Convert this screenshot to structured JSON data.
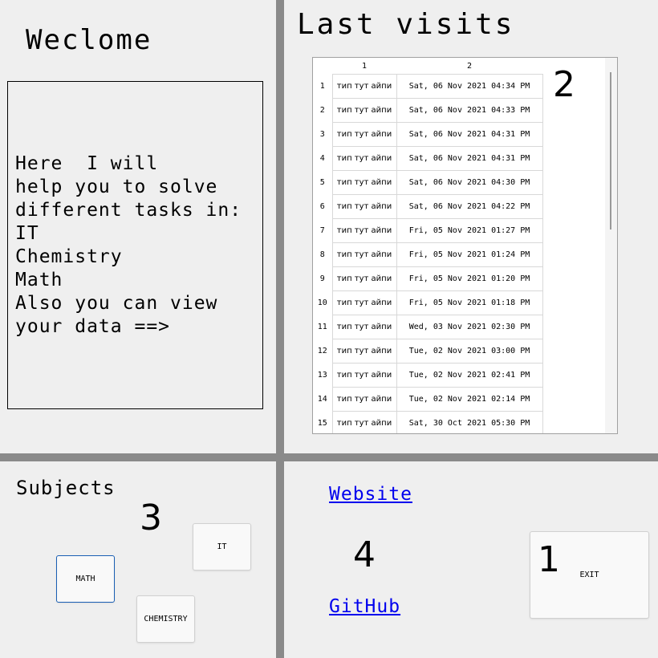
{
  "welcome": {
    "title": "Weclome",
    "lines": [
      "Here  I will",
      "help you to solve",
      "different tasks in:",
      "IT",
      "Chemistry",
      "Math",
      "Also you can view",
      "your data ==>"
    ]
  },
  "visits": {
    "title": "Last visits",
    "columns": [
      "1",
      "2"
    ],
    "rows": [
      {
        "num": "1",
        "name": "тип тут айпи",
        "date": "Sat, 06 Nov 2021 04:34 PM"
      },
      {
        "num": "2",
        "name": "тип тут айпи",
        "date": "Sat, 06 Nov 2021 04:33 PM"
      },
      {
        "num": "3",
        "name": "тип тут айпи",
        "date": "Sat, 06 Nov 2021 04:31 PM"
      },
      {
        "num": "4",
        "name": "тип тут айпи",
        "date": "Sat, 06 Nov 2021 04:31 PM"
      },
      {
        "num": "5",
        "name": "тип тут айпи",
        "date": "Sat, 06 Nov 2021 04:30 PM"
      },
      {
        "num": "6",
        "name": "тип тут айпи",
        "date": "Sat, 06 Nov 2021 04:22 PM"
      },
      {
        "num": "7",
        "name": "тип тут айпи",
        "date": "Fri, 05 Nov 2021 01:27 PM"
      },
      {
        "num": "8",
        "name": "тип тут айпи",
        "date": "Fri, 05 Nov 2021 01:24 PM"
      },
      {
        "num": "9",
        "name": "тип тут айпи",
        "date": "Fri, 05 Nov 2021 01:20 PM"
      },
      {
        "num": "10",
        "name": "тип тут айпи",
        "date": "Fri, 05 Nov 2021 01:18 PM"
      },
      {
        "num": "11",
        "name": "тип тут айпи",
        "date": "Wed, 03 Nov 2021 02:30 PM"
      },
      {
        "num": "12",
        "name": "тип тут айпи",
        "date": "Tue, 02 Nov 2021 03:00 PM"
      },
      {
        "num": "13",
        "name": "тип тут айпи",
        "date": "Tue, 02 Nov 2021 02:41 PM"
      },
      {
        "num": "14",
        "name": "тип тут айпи",
        "date": "Tue, 02 Nov 2021 02:14 PM"
      },
      {
        "num": "15",
        "name": "тип тут айпи",
        "date": "Sat, 30 Oct 2021 05:30 PM"
      }
    ]
  },
  "badges": {
    "visits": "2",
    "subjects": "3",
    "links": "4",
    "exit": "1"
  },
  "subjects": {
    "title": "Subjects",
    "math": "MATH",
    "it": "IT",
    "chemistry": "CHEMISTRY"
  },
  "links": {
    "website": "Website",
    "github": "GitHub"
  },
  "exit": {
    "label": "EXIT"
  },
  "colors": {
    "splitter": "#8a8a8a",
    "background": "#efefef",
    "link": "#0000ee",
    "focus": "#1a5fb4"
  }
}
